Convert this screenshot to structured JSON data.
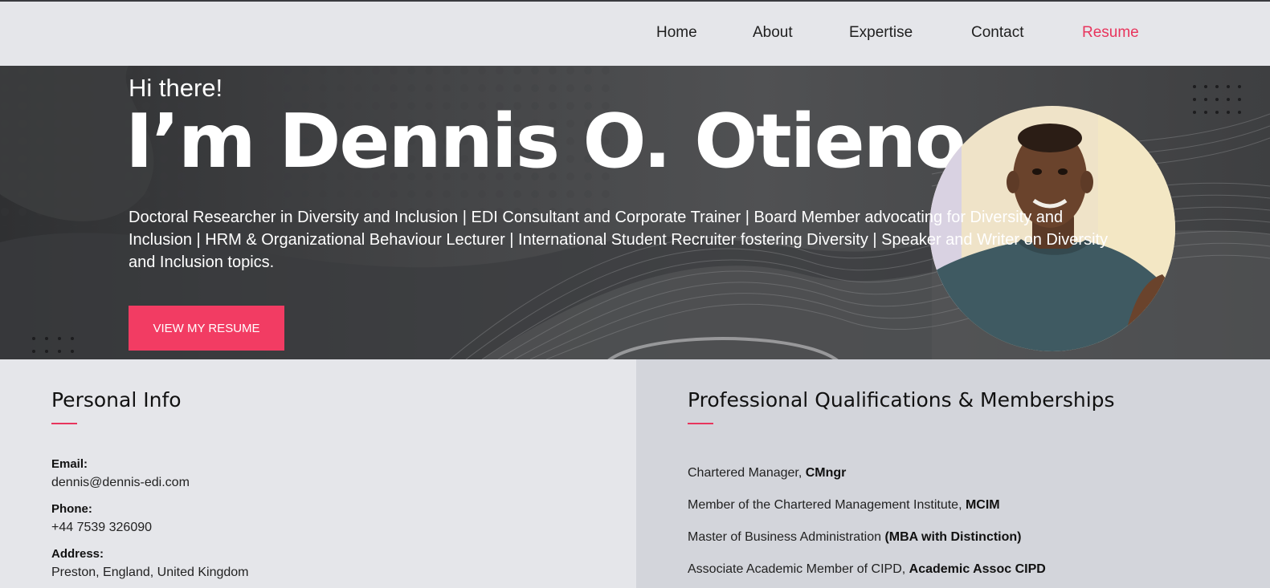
{
  "nav": {
    "items": [
      {
        "label": "Home"
      },
      {
        "label": "About"
      },
      {
        "label": "Expertise"
      },
      {
        "label": "Contact"
      },
      {
        "label": "Resume"
      }
    ],
    "active_index": 4
  },
  "hero": {
    "greeting": "Hi there!",
    "name": "I’m Dennis O. Otieno",
    "description": "Doctoral Researcher in Diversity and Inclusion | EDI Consultant and Corporate Trainer | Board Member advocating for Diversity and Inclusion | HRM & Organizational Behaviour Lecturer | International Student Recruiter fostering Diversity | Speaker and Writer on Diversity and Inclusion topics.",
    "button_label": "VIEW MY RESUME"
  },
  "personal_info": {
    "title": "Personal Info",
    "fields": [
      {
        "label": "Email:",
        "value": "dennis@dennis-edi.com"
      },
      {
        "label": "Phone:",
        "value": "+44 7539 326090"
      },
      {
        "label": "Address:",
        "value": "Preston, England, United Kingdom"
      }
    ]
  },
  "qualifications": {
    "title": "Professional Qualifications & Memberships",
    "items": [
      {
        "text": "Chartered Manager, ",
        "bold": "CMngr"
      },
      {
        "text": "Member of the Chartered Management Institute, ",
        "bold": "MCIM"
      },
      {
        "text": "Master of Business Administration ",
        "bold": "(MBA with Distinction)"
      },
      {
        "text": "Associate Academic Member of CIPD, ",
        "bold": "Academic Assoc CIPD"
      }
    ]
  },
  "colors": {
    "accent": "#e8355d",
    "button": "#f23c63",
    "hero_bg": "#444547",
    "page_bg": "#e5e6ea",
    "right_panel_bg": "#d3d5db"
  }
}
